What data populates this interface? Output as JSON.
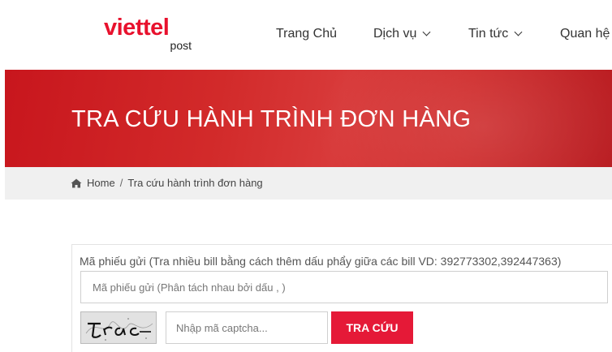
{
  "logo": {
    "main": "viettel",
    "sub": "post"
  },
  "nav": {
    "items": [
      {
        "label": "Trang Chủ",
        "has_dropdown": false
      },
      {
        "label": "Dịch vụ",
        "has_dropdown": true
      },
      {
        "label": "Tin tức",
        "has_dropdown": true
      },
      {
        "label": "Quan hệ",
        "has_dropdown": false
      }
    ]
  },
  "banner": {
    "title": "TRA CỨU HÀNH TRÌNH ĐƠN HÀNG"
  },
  "breadcrumb": {
    "icon": "home-icon",
    "home": "Home",
    "separator": "/",
    "current": "Tra cứu hành trình đơn hàng"
  },
  "form": {
    "label": "Mã phiếu gửi (Tra nhiều bill bằng cách thêm dấu phẩy giữa các bill VD: 392773302,392447363)",
    "bill_placeholder": "Mã phiếu gửi (Phân tách nhau bởi dấu , )",
    "captcha_placeholder": "Nhập mã captcha...",
    "submit_label": "TRA CỨU"
  },
  "colors": {
    "brand": "#e8112d",
    "button": "#e51937",
    "banner": "#cf2a2a"
  }
}
